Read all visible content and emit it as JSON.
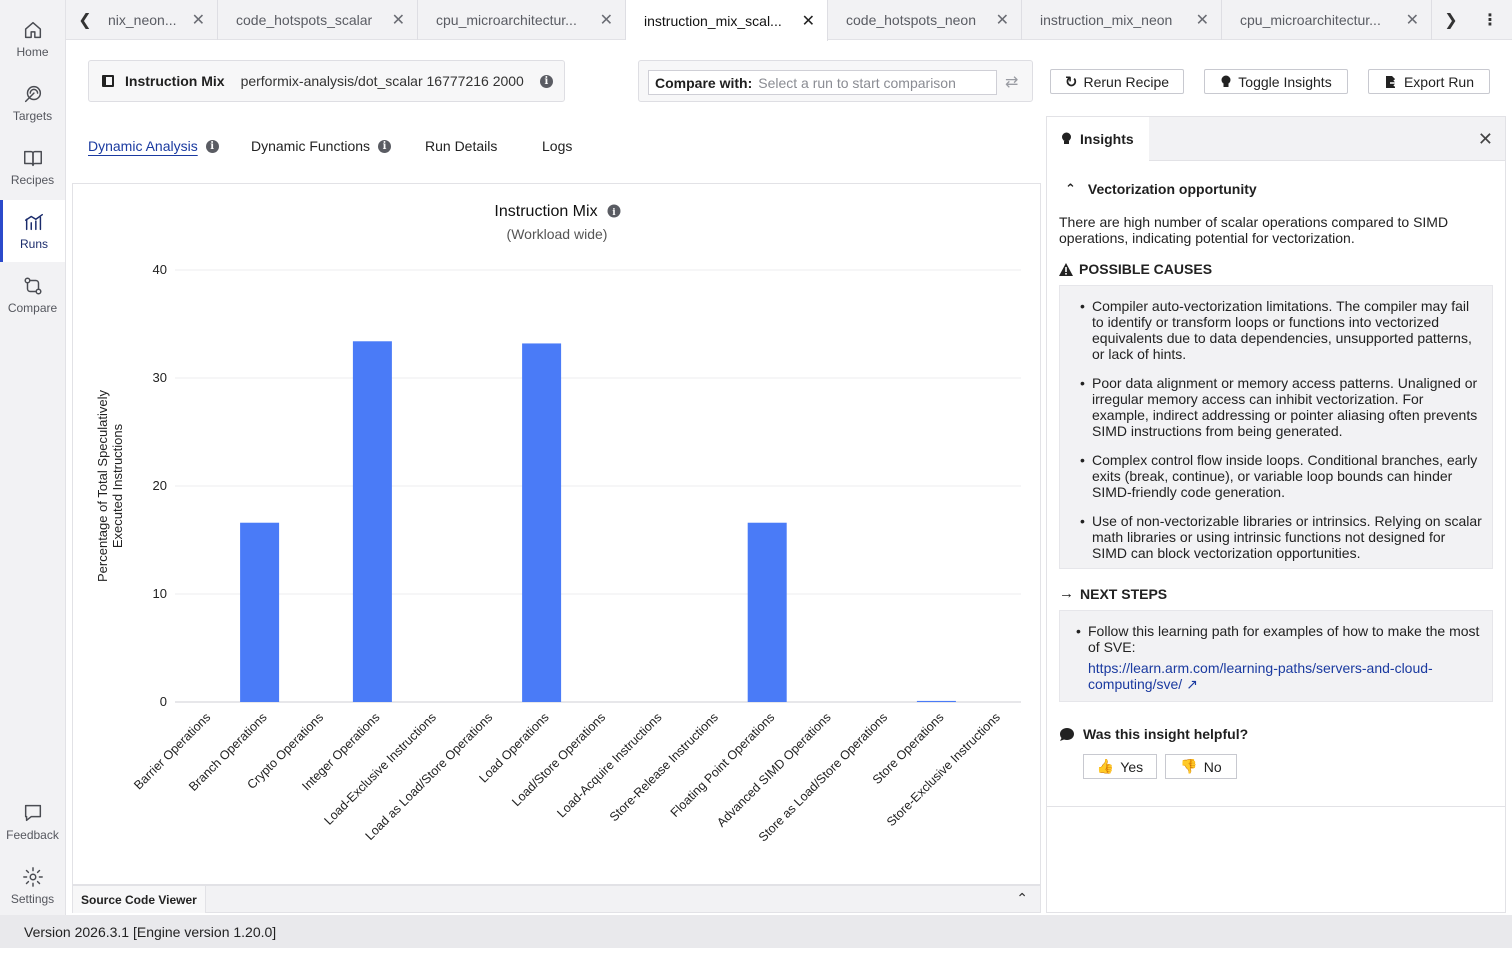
{
  "nav": {
    "items": [
      {
        "label": "Home",
        "icon": "home-icon"
      },
      {
        "label": "Targets",
        "icon": "targets-icon"
      },
      {
        "label": "Recipes",
        "icon": "recipes-icon"
      },
      {
        "label": "Runs",
        "icon": "runs-icon",
        "active": true
      },
      {
        "label": "Compare",
        "icon": "compare-icon"
      }
    ],
    "feedback_label": "Feedback",
    "settings_label": "Settings"
  },
  "tabs": [
    {
      "label": "nix_neon...",
      "active": false
    },
    {
      "label": "code_hotspots_scalar",
      "active": false
    },
    {
      "label": "cpu_microarchitectur...",
      "active": false
    },
    {
      "label": "instruction_mix_scal...",
      "active": true
    },
    {
      "label": "code_hotspots_neon",
      "active": false
    },
    {
      "label": "instruction_mix_neon",
      "active": false
    },
    {
      "label": "cpu_microarchitectur...",
      "active": false
    }
  ],
  "header": {
    "recipe_title": "Instruction Mix",
    "run_path": "performix-analysis/dot_scalar 16777216 2000",
    "compare_label": "Compare with:",
    "compare_placeholder": "Select a run to start comparison",
    "rerun_label": "Rerun Recipe",
    "insights_label": "Toggle Insights",
    "export_label": "Export Run"
  },
  "subtabs": [
    {
      "label": "Dynamic Analysis",
      "info": true,
      "active": true
    },
    {
      "label": "Dynamic Functions",
      "info": true,
      "active": false
    },
    {
      "label": "Run Details",
      "info": false,
      "active": false
    },
    {
      "label": "Logs",
      "info": false,
      "active": false
    }
  ],
  "chart_data": {
    "type": "bar",
    "title": "Instruction Mix",
    "subtitle": "(Workload wide)",
    "xlabel": "",
    "ylabel": "Percentage of Total Speculatively Executed Instructions",
    "ylim": [
      0,
      40
    ],
    "yticks": [
      0,
      10,
      20,
      30,
      40
    ],
    "grid": true,
    "bar_color": "#4a7bf7",
    "categories": [
      "Barrier Operations",
      "Branch Operations",
      "Crypto Operations",
      "Integer Operations",
      "Load-Exclusive Instructions",
      "Load as Load/Store Operations",
      "Load Operations",
      "Load/Store Operations",
      "Load-Acquire Instructions",
      "Store-Release Instructions",
      "Floating Point Operations",
      "Advanced SIMD Operations",
      "Store as Load/Store Operations",
      "Store Operations",
      "Store-Exclusive Instructions"
    ],
    "values": [
      0,
      16.6,
      0,
      33.4,
      0,
      0,
      33.2,
      0,
      0,
      0,
      16.6,
      0,
      0,
      0.1,
      0
    ]
  },
  "source_viewer": {
    "label": "Source Code Viewer"
  },
  "footer": {
    "version": "Version 2026.3.1 [Engine version 1.20.0]"
  },
  "insights": {
    "tab_label": "Insights",
    "title": "Vectorization opportunity",
    "description": "There are high number of scalar operations compared to SIMD operations, indicating potential for vectorization.",
    "causes_heading": "POSSIBLE CAUSES",
    "causes": [
      "Compiler auto-vectorization limitations. The compiler may fail to identify or transform loops or functions into vectorized equivalents due to data dependencies, unsupported patterns, or lack of hints.",
      "Poor data alignment or memory access patterns. Unaligned or irregular memory access can inhibit vectorization. For example, indirect addressing or pointer aliasing often prevents SIMD instructions from being generated.",
      "Complex control flow inside loops. Conditional branches, early exits (break, continue), or variable loop bounds can hinder SIMD-friendly code generation.",
      "Use of non-vectorizable libraries or intrinsics. Relying on scalar math libraries or using intrinsic functions not designed for SIMD can block vectorization opportunities."
    ],
    "next_heading": "NEXT STEPS",
    "next_text": "Follow this learning path for examples of how to make the most of SVE:",
    "next_link": "https://learn.arm.com/learning-paths/servers-and-cloud-computing/sve/",
    "feedback_question": "Was this insight helpful?",
    "yes_label": "Yes",
    "no_label": "No"
  }
}
